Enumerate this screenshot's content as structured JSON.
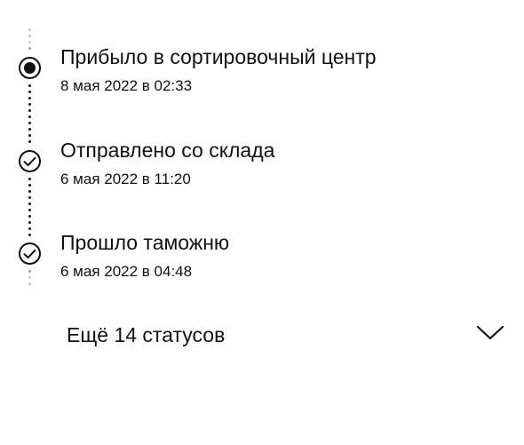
{
  "events": [
    {
      "title": "Прибыло в сортировочный центр",
      "date": "8 мая 2022 в 02:33",
      "state": "current",
      "icon": "filled-circle-icon"
    },
    {
      "title": "Отправлено со склада",
      "date": "6 мая 2022 в 11:20",
      "state": "completed",
      "icon": "check-circle-icon"
    },
    {
      "title": "Прошло таможню",
      "date": "6 мая 2022 в 04:48",
      "state": "completed",
      "icon": "check-circle-icon"
    }
  ],
  "more": {
    "label": "Ещё 14 статусов",
    "icon": "chevron-down-icon"
  },
  "colors": {
    "text": "#111111",
    "faded_dot": "#c8c8c8",
    "background": "#ffffff"
  }
}
